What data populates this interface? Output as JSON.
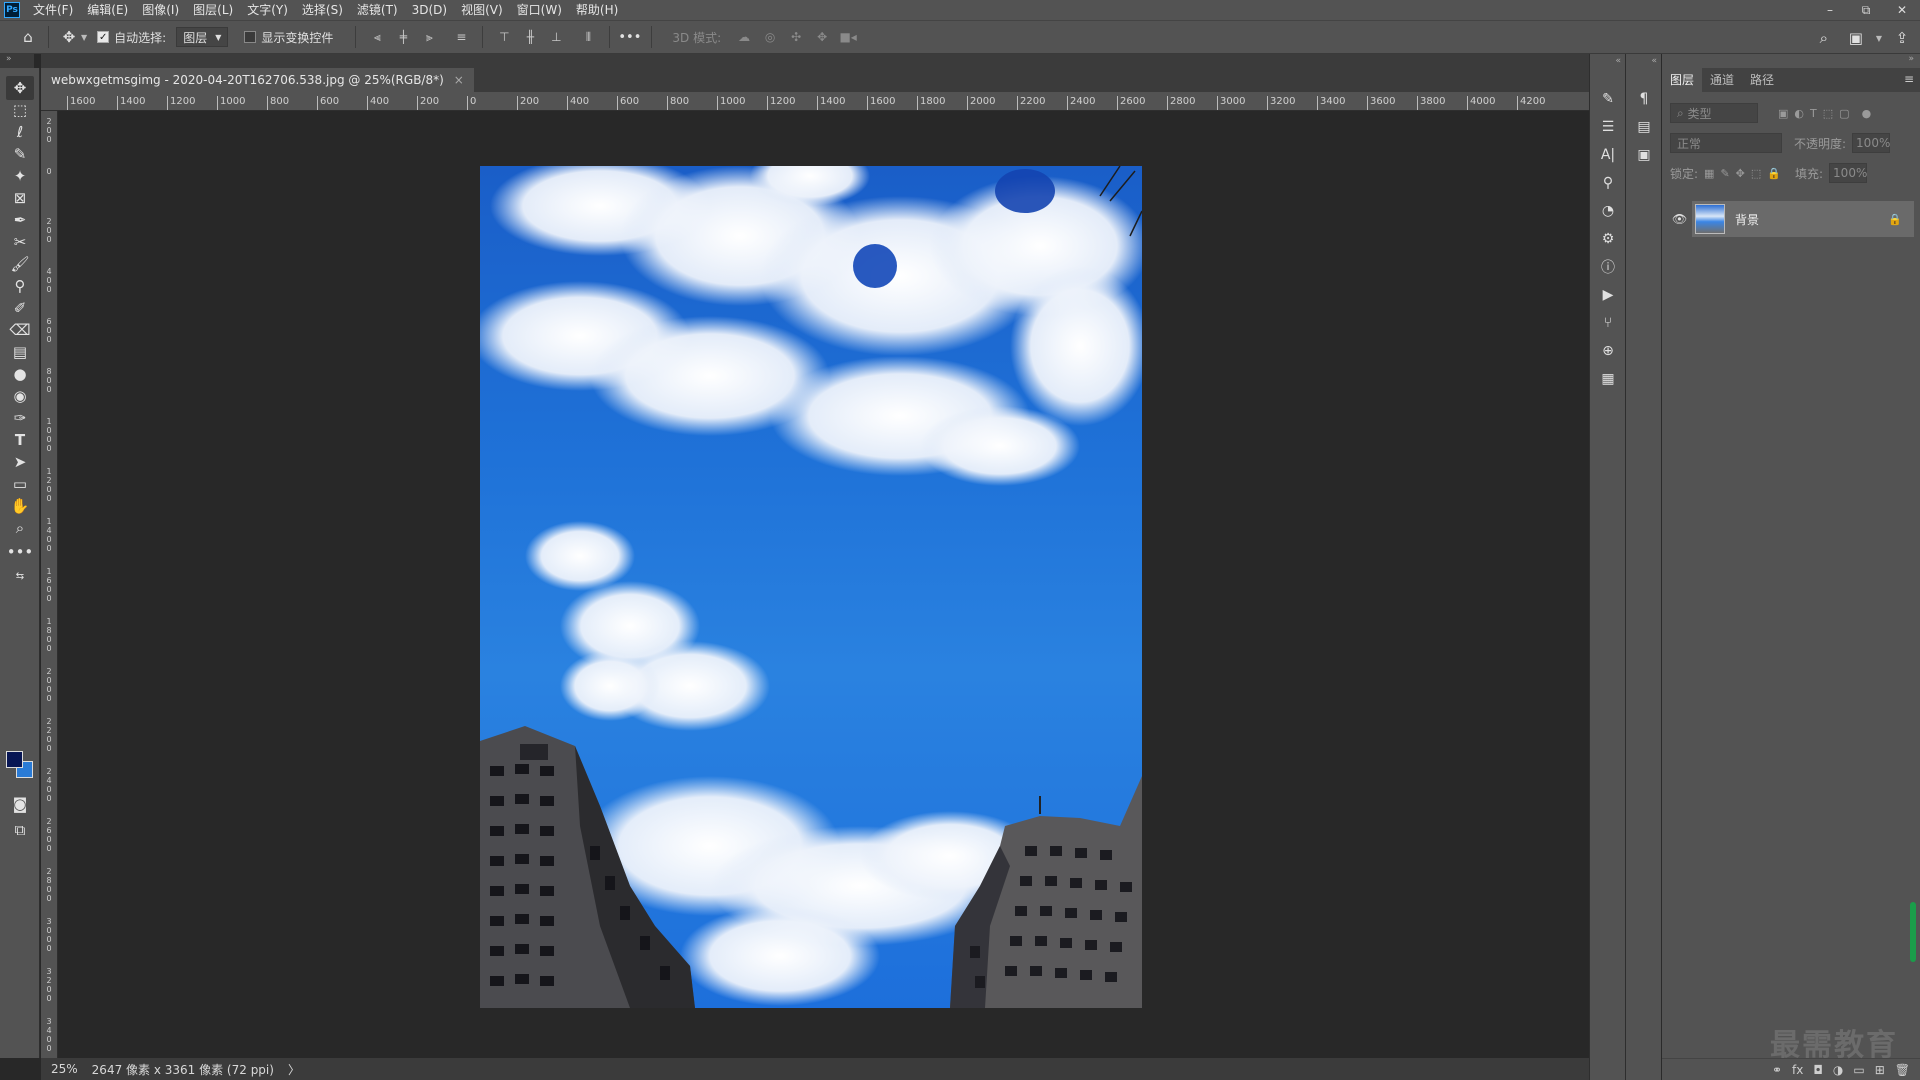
{
  "menubar": {
    "logo": "Ps",
    "items": [
      "文件(F)",
      "编辑(E)",
      "图像(I)",
      "图层(L)",
      "文字(Y)",
      "选择(S)",
      "滤镜(T)",
      "3D(D)",
      "视图(V)",
      "窗口(W)",
      "帮助(H)"
    ],
    "window_controls": [
      "–",
      "⧉",
      "✕"
    ]
  },
  "options": {
    "auto_select_label": "自动选择:",
    "auto_select_target": "图层",
    "show_transform_label": "显示变换控件",
    "more": "•••",
    "mode_3d_label": "3D 模式:"
  },
  "document": {
    "tab_title": "webwxgetmsgimg - 2020-04-20T162706.538.jpg @ 25%(RGB/8*)",
    "close": "×"
  },
  "ruler": {
    "h_labels": [
      "1600",
      "1400",
      "1200",
      "1000",
      "800",
      "600",
      "400",
      "200",
      "0",
      "200",
      "400",
      "600",
      "800",
      "1000",
      "1200",
      "1400",
      "1600",
      "1800",
      "2000",
      "2200",
      "2400",
      "2600",
      "2800",
      "3000",
      "3200",
      "3400",
      "3600",
      "3800",
      "4000",
      "4200"
    ],
    "v_labels": [
      "2\n0\n0",
      "0",
      "2\n0\n0",
      "4\n0\n0",
      "6\n0\n0",
      "8\n0\n0",
      "1\n0\n0\n0",
      "1\n2\n0\n0",
      "1\n4\n0\n0",
      "1\n6\n0\n0",
      "1\n8\n0\n0",
      "2\n0\n0\n0",
      "2\n2\n0\n0",
      "2\n4\n0\n0",
      "2\n6\n0\n0",
      "2\n8\n0\n0",
      "3\n0\n0\n0",
      "3\n2\n0\n0",
      "3\n4\n0\n0"
    ]
  },
  "status": {
    "zoom": "25%",
    "doc_info": "2647 像素 x 3361 像素 (72 ppi)",
    "arrow": "〉"
  },
  "layers_panel": {
    "tabs": [
      "图层",
      "通道",
      "路径"
    ],
    "filter_placeholder": "类型",
    "blend_mode": "正常",
    "opacity_label": "不透明度:",
    "opacity_value": "100%",
    "lock_label": "锁定:",
    "fill_label": "填充:",
    "fill_value": "100%",
    "layer_name": "背景",
    "bottom_icons": [
      "⚭",
      "fx",
      "◘",
      "◑",
      "▭",
      "⊞",
      "🗑"
    ]
  },
  "watermark": "最需教育"
}
